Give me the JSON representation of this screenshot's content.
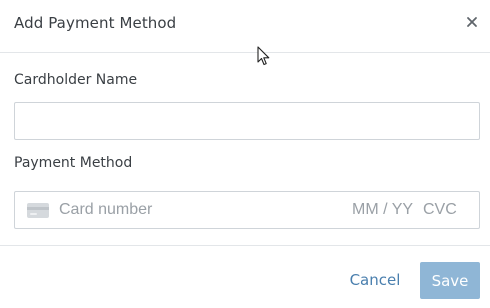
{
  "dialog": {
    "title": "Add Payment Method",
    "close_icon": "close-icon"
  },
  "form": {
    "cardholder_label": "Cardholder Name",
    "cardholder_value": "",
    "cardholder_placeholder": "",
    "payment_method_label": "Payment Method",
    "card_icon": "credit-card-icon",
    "card_number_placeholder": "Card number",
    "expiry_placeholder": "MM / YY",
    "cvc_placeholder": "CVC"
  },
  "footer": {
    "cancel_label": "Cancel",
    "save_label": "Save"
  },
  "colors": {
    "link": "#4a7fae",
    "primary_disabled": "#8fb6d6",
    "border": "#cfd4d9",
    "placeholder": "#9aa0a6"
  }
}
